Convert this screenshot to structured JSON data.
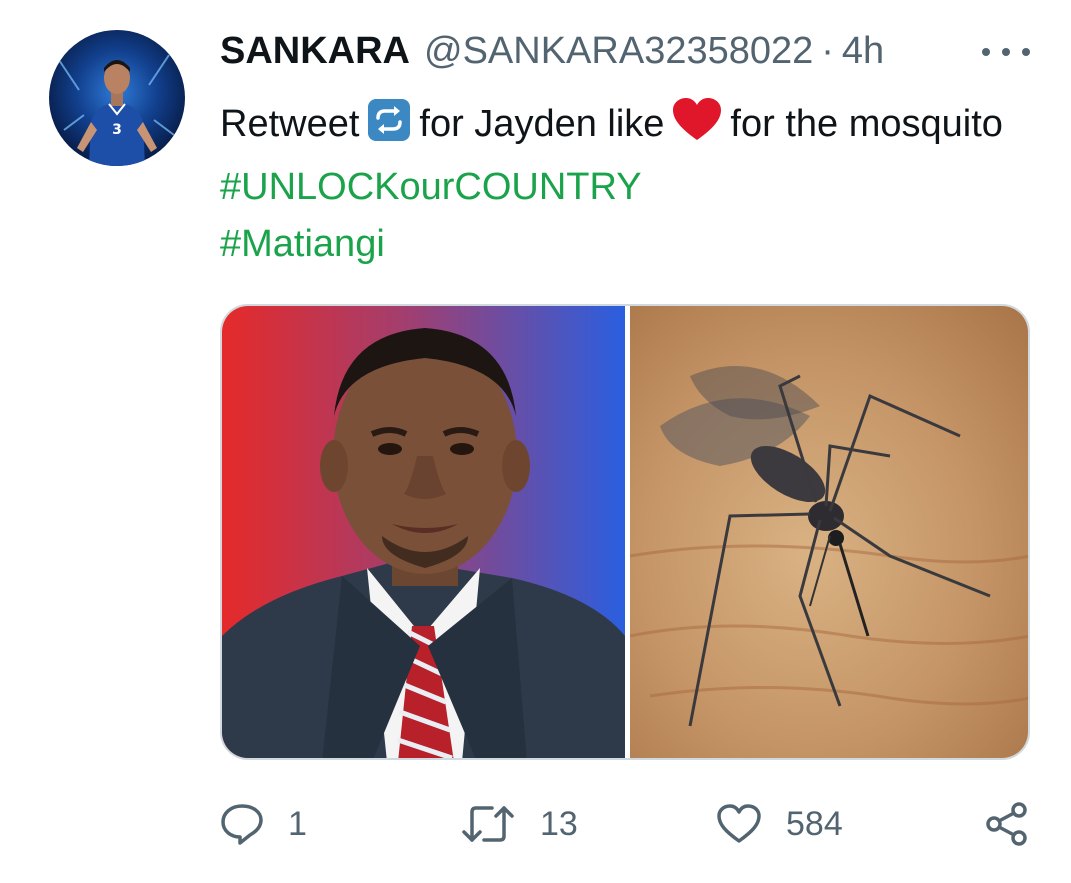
{
  "tweet": {
    "author": {
      "display_name": "SANKARA",
      "handle": "@SANKARA32358022",
      "separator": "·",
      "time": "4h"
    },
    "text": {
      "part1": "Retweet",
      "part2": "for Jayden like",
      "part3": "for the mosquito",
      "hashtag1": "#UNLOCKourCOUNTRY",
      "hashtag2": "#Matiangi"
    },
    "icons": {
      "retweet_emoji": "repeat-button-emoji",
      "heart_emoji": "red-heart-emoji",
      "more": "more-options-icon"
    },
    "actions": {
      "reply_count": "1",
      "retweet_count": "13",
      "like_count": "584"
    },
    "colors": {
      "hashtag": "#1aa34a",
      "secondary_text": "#536471",
      "heart": "#e0162b",
      "retweet_emoji_bg": "#3b88c3"
    }
  }
}
